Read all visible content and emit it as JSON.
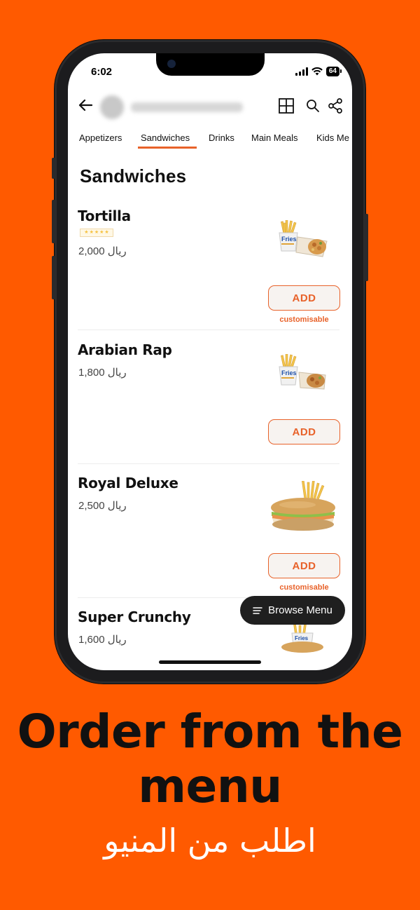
{
  "status": {
    "time": "6:02",
    "battery": "64"
  },
  "tabs": [
    "Appetizers",
    "Sandwiches",
    "Drinks",
    "Main Meals",
    "Kids Me"
  ],
  "section_title": "Sandwiches",
  "items": [
    {
      "name": "Tortilla",
      "price": "2,000 ريال",
      "rating_stars": 5,
      "add_label": "ADD",
      "customisable_label": "customisable"
    },
    {
      "name": "Arabian Rap",
      "price": "1,800 ريال",
      "add_label": "ADD"
    },
    {
      "name": "Royal Deluxe",
      "price": "2,500 ريال",
      "add_label": "ADD",
      "customisable_label": "customisable"
    },
    {
      "name": "Super Crunchy",
      "price": "1,600 ريال"
    }
  ],
  "browse_menu_label": "Browse Menu",
  "headline": "Order from the menu",
  "headline_arabic": "اطلب من المنيو",
  "colors": {
    "background": "#ff5a00",
    "accent": "#e8622a",
    "fab": "#1f1f1f"
  },
  "icons": [
    "back-arrow-icon",
    "grid-icon",
    "search-icon",
    "share-icon",
    "menu-lines-icon",
    "star-icon"
  ]
}
